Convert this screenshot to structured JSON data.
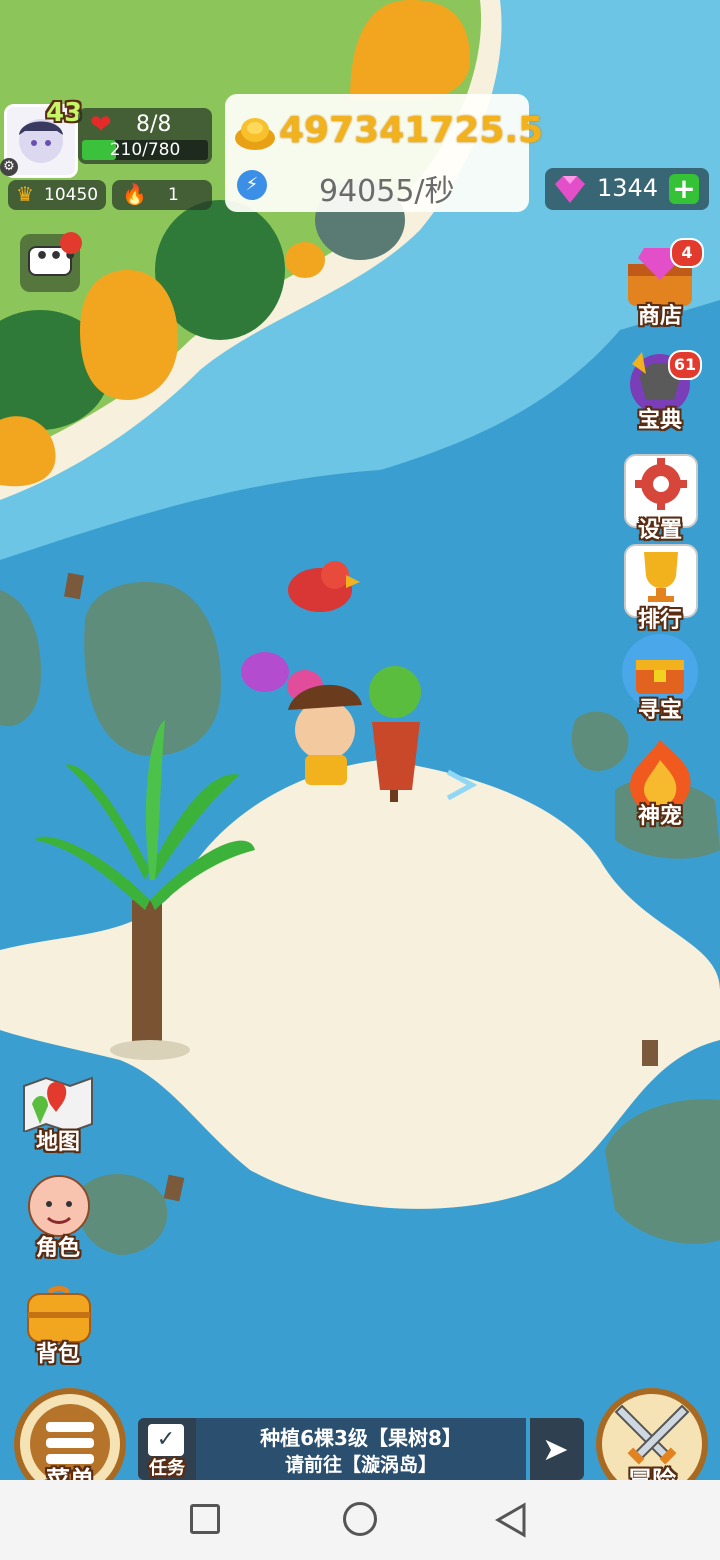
{
  "player": {
    "level": "43",
    "hp": "8/8",
    "exp": "210/780",
    "exp_fraction": 0.27,
    "crown_value": "10450",
    "fire_value": "1"
  },
  "currency": {
    "gold": "497341725.5",
    "rate": "94055/秒",
    "gems": "1344"
  },
  "side_menu": [
    {
      "label": "商店",
      "badge": "4",
      "icon": "shop-chest-icon"
    },
    {
      "label": "宝典",
      "badge": "61",
      "icon": "codex-helmet-icon"
    },
    {
      "label": "设置",
      "icon": "gear-icon"
    },
    {
      "label": "排行",
      "icon": "trophy-icon"
    },
    {
      "label": "寻宝",
      "icon": "treasure-chest-icon"
    },
    {
      "label": "神宠",
      "icon": "fire-pet-icon"
    }
  ],
  "left_menu": [
    {
      "label": "地图",
      "icon": "map-icon"
    },
    {
      "label": "角色",
      "icon": "character-face-icon"
    },
    {
      "label": "背包",
      "icon": "backpack-icon"
    }
  ],
  "bottom": {
    "menu_label": "菜单",
    "task_label": "任务",
    "task_line1": "种植6棵3级【果树8】",
    "task_line2": "请前往【漩涡岛】",
    "adventure_label": "冒险"
  },
  "colors": {
    "gold_text": "#f2b21e",
    "exp_bar": "#3cc13c",
    "water": "#3a9fd0",
    "sand": "#f6f0dc",
    "grass": "#8cc65a",
    "badge": "#e23b2e"
  }
}
